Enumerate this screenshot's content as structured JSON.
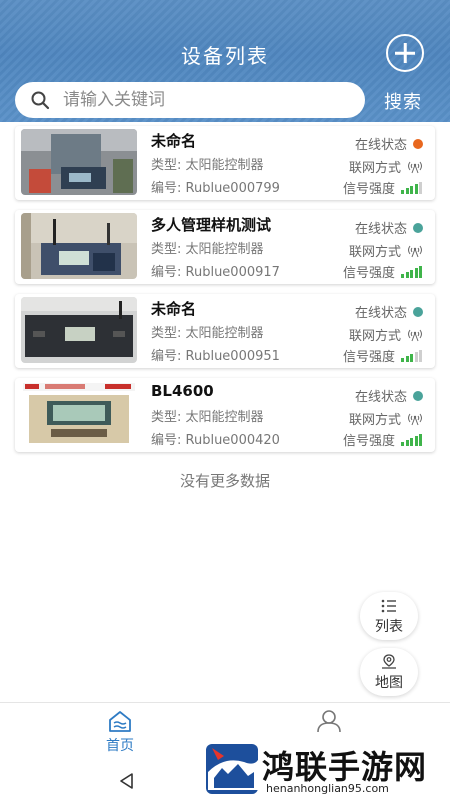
{
  "header": {
    "title": "设备列表",
    "add_icon": "plus-circle-icon",
    "search_placeholder": "请输入关键词",
    "search_button": "搜索"
  },
  "devices": [
    {
      "name": "未命名",
      "type": "类型: 太阳能控制器",
      "serial": "编号: Rublue000799",
      "status_label": "在线状态",
      "status_color": "#e8671e",
      "network_label": "联网方式",
      "signal_label": "信号强度",
      "signal_level": 0.75
    },
    {
      "name": "多人管理样机测试",
      "type": "类型: 太阳能控制器",
      "serial": "编号: Rublue000917",
      "status_label": "在线状态",
      "status_color": "#4aa39a",
      "network_label": "联网方式",
      "signal_label": "信号强度",
      "signal_level": 1.0
    },
    {
      "name": "未命名",
      "type": "类型: 太阳能控制器",
      "serial": "编号: Rublue000951",
      "status_label": "在线状态",
      "status_color": "#4aa39a",
      "network_label": "联网方式",
      "signal_label": "信号强度",
      "signal_level": 0.5
    },
    {
      "name": "BL4600",
      "type": "类型: 太阳能控制器",
      "serial": "编号: Rublue000420",
      "status_label": "在线状态",
      "status_color": "#4aa39a",
      "network_label": "联网方式",
      "signal_label": "信号强度",
      "signal_level": 1.0
    }
  ],
  "footer_text": "没有更多数据",
  "floating": {
    "list_label": "列表",
    "map_label": "地图"
  },
  "tabs": {
    "home_label": "首页",
    "home_color": "#2e7bc4"
  },
  "watermark": {
    "title": "鸿联手游网",
    "url": "henanhonglian95.com"
  }
}
